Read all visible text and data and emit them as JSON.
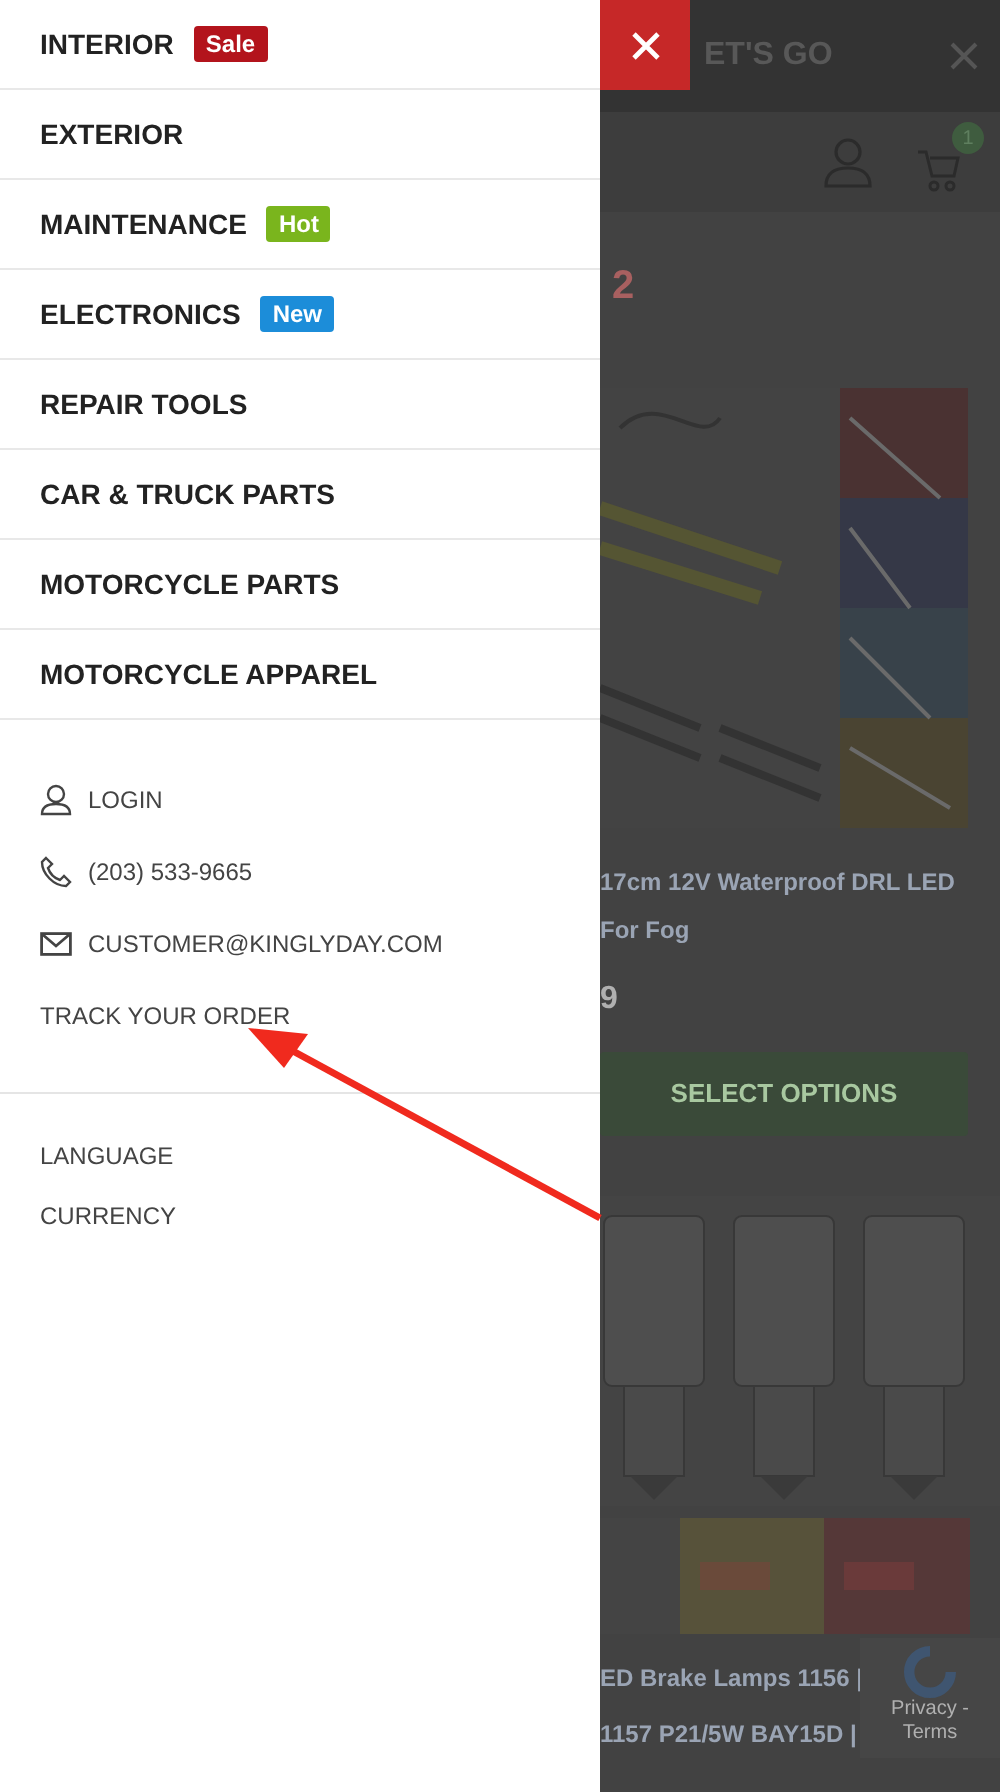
{
  "menu": {
    "items": [
      {
        "label": "INTERIOR",
        "badge": {
          "text": "Sale",
          "color": "#b3141c"
        }
      },
      {
        "label": "EXTERIOR"
      },
      {
        "label": "MAINTENANCE",
        "badge": {
          "text": "Hot",
          "color": "#7ab51d"
        }
      },
      {
        "label": "ELECTRONICS",
        "badge": {
          "text": "New",
          "color": "#1c8dd9"
        }
      },
      {
        "label": "REPAIR TOOLS"
      },
      {
        "label": "CAR & TRUCK PARTS"
      },
      {
        "label": "MOTORCYCLE PARTS"
      },
      {
        "label": "MOTORCYCLE APPAREL"
      }
    ]
  },
  "account_links": [
    {
      "kind": "user",
      "label": "LOGIN"
    },
    {
      "kind": "phone",
      "label": "(203) 533-9665"
    },
    {
      "kind": "mail",
      "label": "CUSTOMER@KINGLYDAY.COM"
    },
    {
      "kind": "plain",
      "label": "TRACK YOUR ORDER"
    }
  ],
  "settings": [
    "LANGUAGE",
    "CURRENCY"
  ],
  "background_page": {
    "banner_text": "ET'S GO",
    "cart_count": "1",
    "heading": "2",
    "products": [
      {
        "title_lines": [
          "17cm 12V Waterproof DRL LED",
          "For Fog"
        ],
        "price": "9",
        "button": "SELECT OPTIONS"
      },
      {
        "title_lines": [
          "ED Brake Lamps 1156 |",
          "1157 P21/5W BAY15D |"
        ]
      }
    ],
    "recaptcha": "Privacy - Terms"
  }
}
